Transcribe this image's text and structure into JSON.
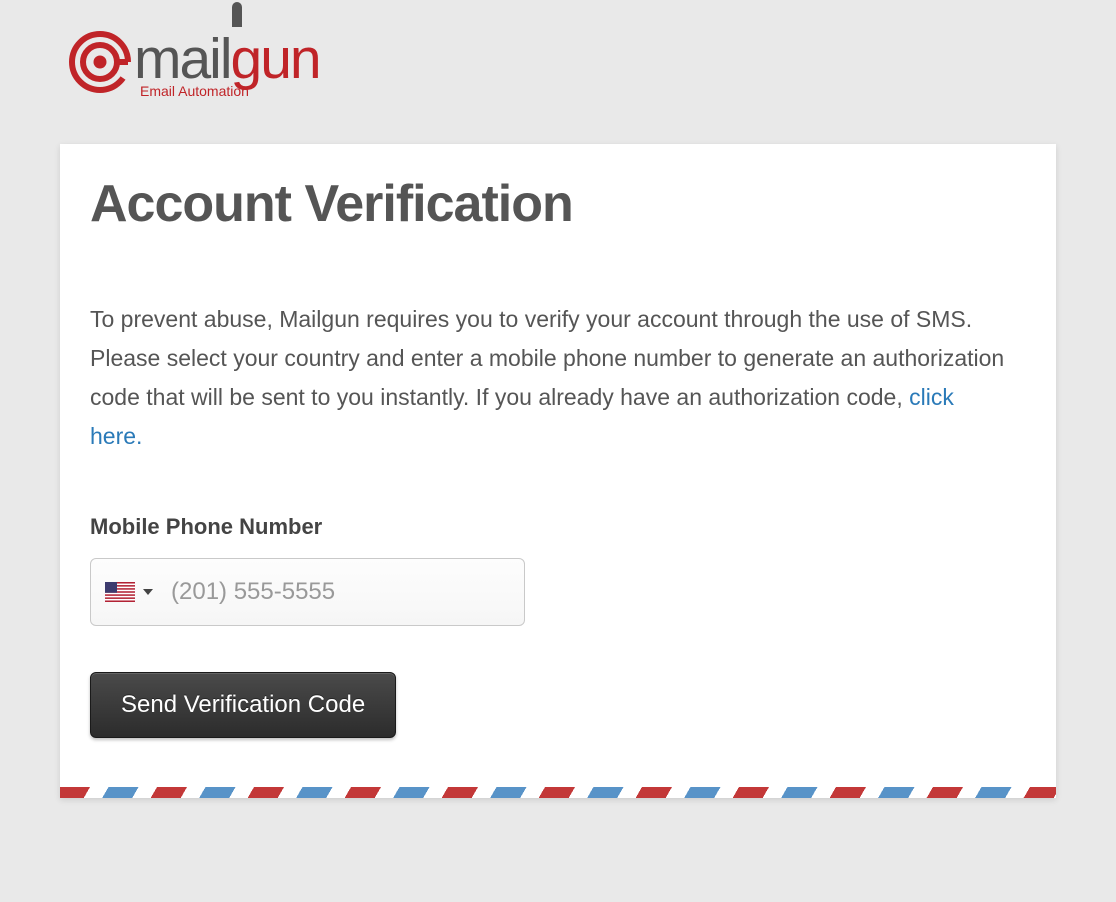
{
  "logo": {
    "word1": "mail",
    "word2": "gun",
    "tagline": "Email Automation"
  },
  "card": {
    "title": "Account Verification",
    "desc_part1": "To prevent abuse, Mailgun requires you to verify your account through the use of SMS. Please select your country and enter a mobile phone number to generate an authorization code that will be sent to you instantly. If you already have an authorization code, ",
    "desc_link": "click here.",
    "field_label": "Mobile Phone Number",
    "phone_placeholder": "(201) 555-5555",
    "country_selected": "us",
    "submit_label": "Send Verification Code"
  }
}
